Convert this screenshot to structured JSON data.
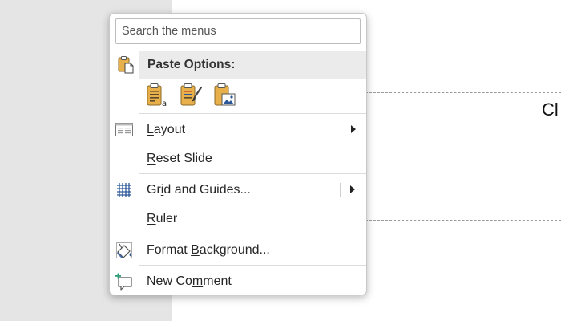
{
  "slide": {
    "visible_text": "Cl"
  },
  "context_menu": {
    "search": {
      "placeholder": "Search the menus",
      "value": ""
    },
    "paste_options": {
      "header": "Paste Options:",
      "buttons": [
        {
          "name": "use-destination-theme",
          "icon": "clipboard-text-icon"
        },
        {
          "name": "keep-source-formatting",
          "icon": "clipboard-brush-icon"
        },
        {
          "name": "picture",
          "icon": "clipboard-picture-icon"
        }
      ]
    },
    "items": {
      "layout": {
        "pre": "",
        "accel": "L",
        "post": "ayout",
        "icon": "layout-icon",
        "submenu": true
      },
      "reset_slide": {
        "pre": "",
        "accel": "R",
        "post": "eset Slide",
        "icon": "",
        "submenu": false
      },
      "grid_guides": {
        "pre": "Gr",
        "accel": "i",
        "post": "d and Guides...",
        "icon": "grid-icon",
        "submenu": true
      },
      "ruler": {
        "pre": "",
        "accel": "R",
        "post": "uler",
        "icon": "",
        "submenu": false
      },
      "format_background": {
        "pre": "Format ",
        "accel": "B",
        "post": "ackground...",
        "icon": "format-background-icon",
        "submenu": false
      },
      "new_comment": {
        "pre": "New Co",
        "accel": "m",
        "post": "ment",
        "icon": "new-comment-icon",
        "submenu": false
      }
    }
  },
  "colors": {
    "clipboard": "#e8b04a",
    "clipboard_dark": "#8a6a2a",
    "grid": "#2b5797",
    "comment_accent": "#2e9c74",
    "hover_row": "#ebebeb"
  }
}
